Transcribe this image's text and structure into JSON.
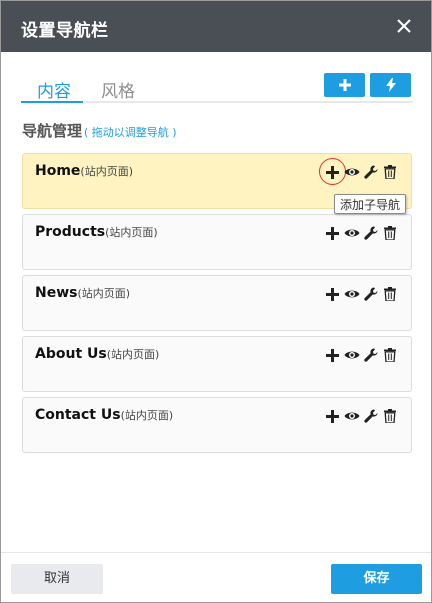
{
  "dialog": {
    "title": "设置导航栏"
  },
  "tabs": [
    {
      "label": "内容",
      "active": true
    },
    {
      "label": "风格",
      "active": false
    }
  ],
  "toolbar": {
    "add_icon": "plus-icon",
    "bolt_icon": "lightning-icon"
  },
  "section": {
    "title": "导航管理",
    "hint": "( 拖动以调整导航 )"
  },
  "nav_items": [
    {
      "label": "Home",
      "type": "(站内页面)",
      "highlighted": true
    },
    {
      "label": "Products",
      "type": "(站内页面)",
      "highlighted": false
    },
    {
      "label": "News",
      "type": "(站内页面)",
      "highlighted": false
    },
    {
      "label": "About Us",
      "type": "(站内页面)",
      "highlighted": false
    },
    {
      "label": "Contact Us",
      "type": "(站内页面)",
      "highlighted": false
    }
  ],
  "item_actions": [
    "plus-icon",
    "eye-icon",
    "wrench-icon",
    "trash-icon"
  ],
  "tooltip": "添加子导航",
  "footer": {
    "cancel_label": "取消",
    "save_label": "保存"
  },
  "colors": {
    "header_bg": "#4a4f56",
    "accent": "#1e9ee0",
    "highlight_row": "#fff3c2",
    "hover_ring": "#e03030"
  }
}
